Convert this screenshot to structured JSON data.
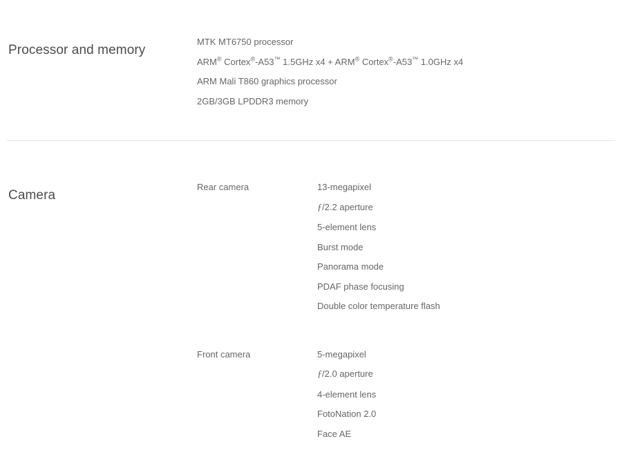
{
  "page": {
    "background_color": "#ffffff",
    "text_color": "#666666",
    "heading_color": "#4c4c4c",
    "divider_color": "#e6e6e6"
  },
  "sections": [
    {
      "id": "processor-and-memory",
      "title": "Processor and memory",
      "layout": "plain-list",
      "items": [
        {
          "text": "MTK MT6750 processor"
        },
        {
          "text": "ARM® Cortex®-A53™ 1.5GHz x4 + ARM® Cortex®-A53™ 1.0GHz x4"
        },
        {
          "text": "ARM Mali T860 graphics processor"
        },
        {
          "text": "2GB/3GB LPDDR3 memory"
        }
      ]
    },
    {
      "id": "camera",
      "title": "Camera",
      "layout": "grouped-list",
      "groups": [
        {
          "id": "rear-camera",
          "label": "Rear camera",
          "values": [
            "13-megapixel",
            "ƒ/2.2 aperture",
            "5-element lens",
            "Burst mode",
            "Panorama mode",
            "PDAF phase focusing",
            "Double color temperature flash"
          ]
        },
        {
          "id": "front-camera",
          "label": "Front camera",
          "values": [
            "5-megapixel",
            "ƒ/2.0 aperture",
            "4-element lens",
            "FotoNation 2.0",
            "Face AE"
          ]
        }
      ]
    }
  ]
}
